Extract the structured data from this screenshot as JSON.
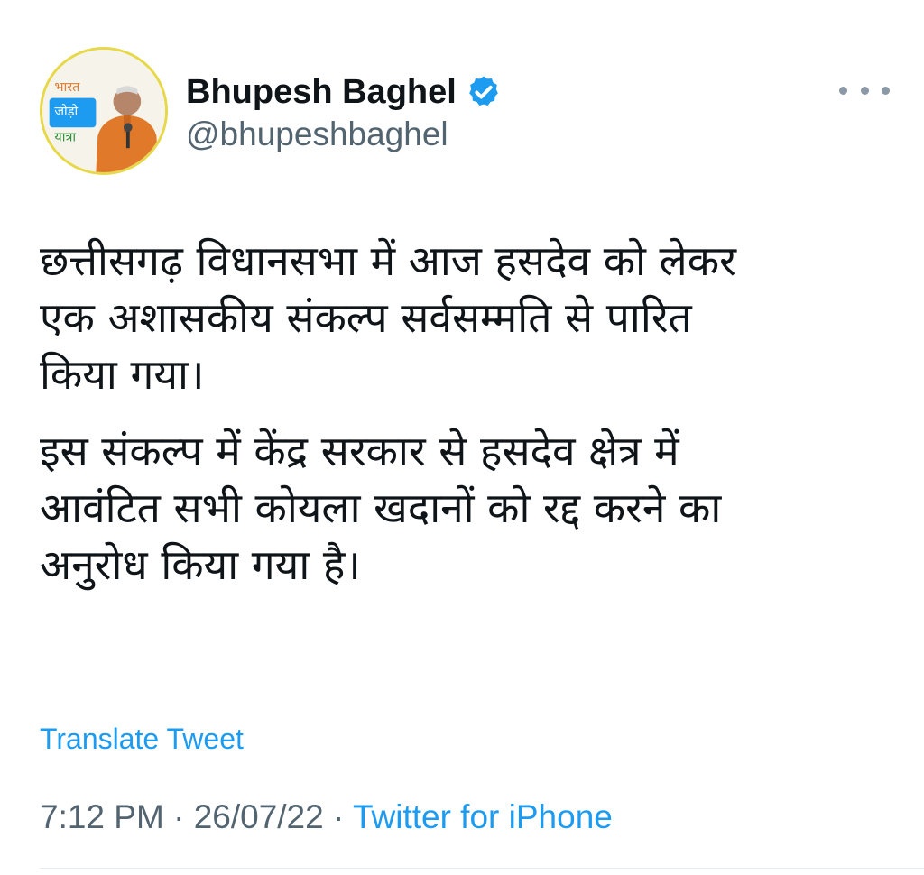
{
  "author": {
    "display_name": "Bhupesh Baghel",
    "handle": "@bhupeshbaghel",
    "verified": true,
    "avatar_icon": "profile-photo-icon",
    "avatar_badge_lines": [
      "भारत",
      "जोड़ो",
      "यात्रा"
    ]
  },
  "tweet": {
    "paragraphs": [
      "छत्तीसगढ़ विधानसभा में आज हसदेव को लेकर\nएक अशासकीय संकल्प सर्वसम्मति से पारित\nकिया गया।",
      "इस संकल्प में केंद्र सरकार से हसदेव क्षेत्र में\nआवंटित सभी कोयला खदानों को रद्द करने का\nअनुरोध किया गया है।"
    ],
    "translate_label": "Translate Tweet",
    "time": "7:12 PM",
    "separator": " · ",
    "date": "26/07/22",
    "source": "Twitter for iPhone"
  },
  "icons": {
    "verified": "verified-badge-icon",
    "more": "more-options-icon"
  },
  "colors": {
    "accent": "#1d9bf0",
    "text_primary": "#0f1419",
    "text_secondary": "#536471",
    "avatar_ring": "#e7d84a"
  }
}
